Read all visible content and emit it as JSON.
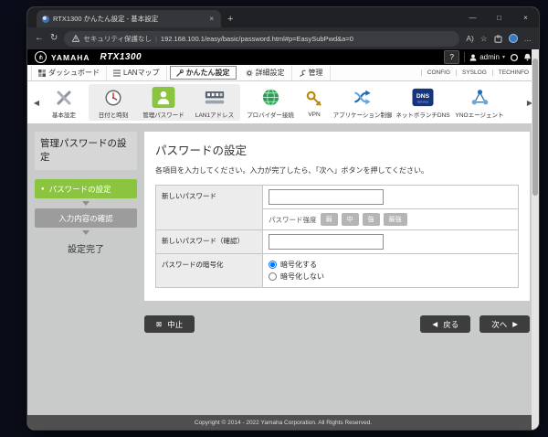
{
  "browser": {
    "tab": {
      "title": "RTX1300 かんたん設定 - 基本設定"
    },
    "address": {
      "security": "セキュリティ保護なし",
      "url": "192.168.100.1/easy/basic/password.html#p=EasySubPwd&a=0"
    }
  },
  "glyphs": {
    "tab_close": "×",
    "new_tab": "+",
    "minimize": "—",
    "maximize": "□",
    "window_close": "×",
    "back": "←",
    "refresh": "↻",
    "read_aloud": "A)",
    "favorite": "☆",
    "more": "…",
    "tuning_fork": "⋔",
    "caret_down": "▾",
    "bullet": "●",
    "nav_left": "◀",
    "nav_right": "▶",
    "cancel_box": "⊠",
    "back_arrow": "◀",
    "next_arrow": "▶",
    "url_divider": "|"
  },
  "app": {
    "brand": "YAMAHA",
    "model": "RTX1300",
    "help": "?",
    "user": "admin"
  },
  "menubar": {
    "tabs": [
      {
        "label": "ダッシュボード"
      },
      {
        "label": "LANマップ"
      },
      {
        "label": "かんたん設定"
      },
      {
        "label": "詳細設定"
      },
      {
        "label": "管理"
      }
    ],
    "links": [
      "CONFIG",
      "SYSLOG",
      "TECHINFO"
    ]
  },
  "icon_nav": {
    "items": [
      {
        "label": "基本設定"
      },
      {
        "label": "日付と時刻"
      },
      {
        "label": "管理パスワード"
      },
      {
        "label": "LAN1アドレス"
      },
      {
        "label": "プロバイダー接続"
      },
      {
        "label": "VPN"
      },
      {
        "label": "アプリケーション制御"
      },
      {
        "label": "ネットボランチDNS",
        "icon_text": "DNS",
        "icon_sub": "Service"
      },
      {
        "label": "YNOエージェント"
      }
    ]
  },
  "wizard": {
    "title": "管理パスワードの設定",
    "steps": [
      {
        "label": "パスワードの設定"
      },
      {
        "label": "入力内容の確認"
      },
      {
        "label": "設定完了"
      }
    ]
  },
  "form": {
    "title": "パスワードの設定",
    "description": "各項目を入力してください。入力が完了したら、「次へ」ボタンを押してください。",
    "new_password_label": "新しいパスワード",
    "strength_label": "パスワード強度",
    "strength_levels": [
      "弱",
      "中",
      "強",
      "最強"
    ],
    "confirm_label": "新しいパスワード（確認）",
    "encrypt_label": "パスワードの暗号化",
    "encrypt_options": [
      "暗号化する",
      "暗号化しない"
    ],
    "encrypt_selected": "暗号化する"
  },
  "buttons": {
    "cancel": "中止",
    "back": "戻る",
    "next": "次へ"
  },
  "footer": {
    "copyright": "Copyright © 2014 - 2022 Yamaha Corporation. All Rights Reserved."
  },
  "colors": {
    "accent_green": "#8bc53f",
    "button_dark": "#3d3d3d",
    "header_black": "#000000"
  }
}
